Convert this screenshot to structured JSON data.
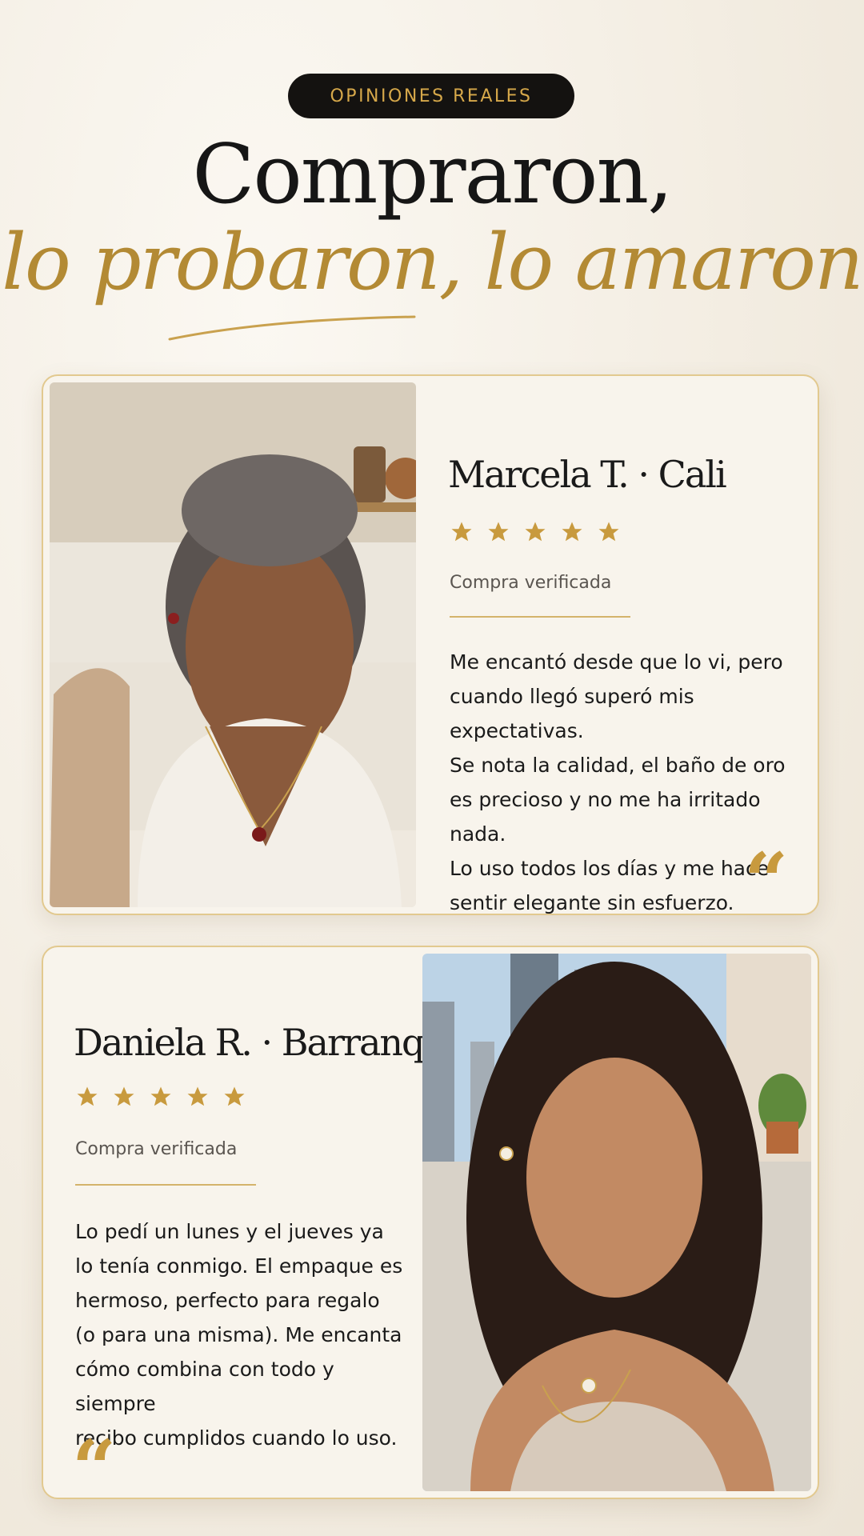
{
  "header": {
    "badge": "OPINIONES REALES",
    "title_line1": "Compraron,",
    "title_line2": "lo probaron, lo amaron"
  },
  "colors": {
    "gold": "#c89a3e",
    "dark": "#141210",
    "cream": "#f8f4ec"
  },
  "reviews": [
    {
      "name": "Marcela T. · Cali",
      "rating": 5,
      "verified": "Compra verificada",
      "lines": [
        "Me encantó desde que lo vi, pero",
        "cuando llegó superó mis expectativas.",
        "Se nota la calidad, el baño de oro",
        "es precioso y no me ha irritado nada.",
        "Lo uso todos los días y me hace",
        "sentir elegante sin esfuerzo."
      ],
      "quote_icon": "quote-icon"
    },
    {
      "name": "Daniela R. · Barranquilla",
      "rating": 5,
      "verified": "Compra verificada",
      "lines": [
        "Lo pedí un lunes y el jueves ya",
        "lo tenía conmigo. El empaque es",
        "hermoso, perfecto para regalo",
        "(o para una misma). Me encanta",
        "cómo combina con todo y siempre",
        "recibo cumplidos cuando lo uso."
      ],
      "quote_icon": "quote-icon"
    }
  ]
}
